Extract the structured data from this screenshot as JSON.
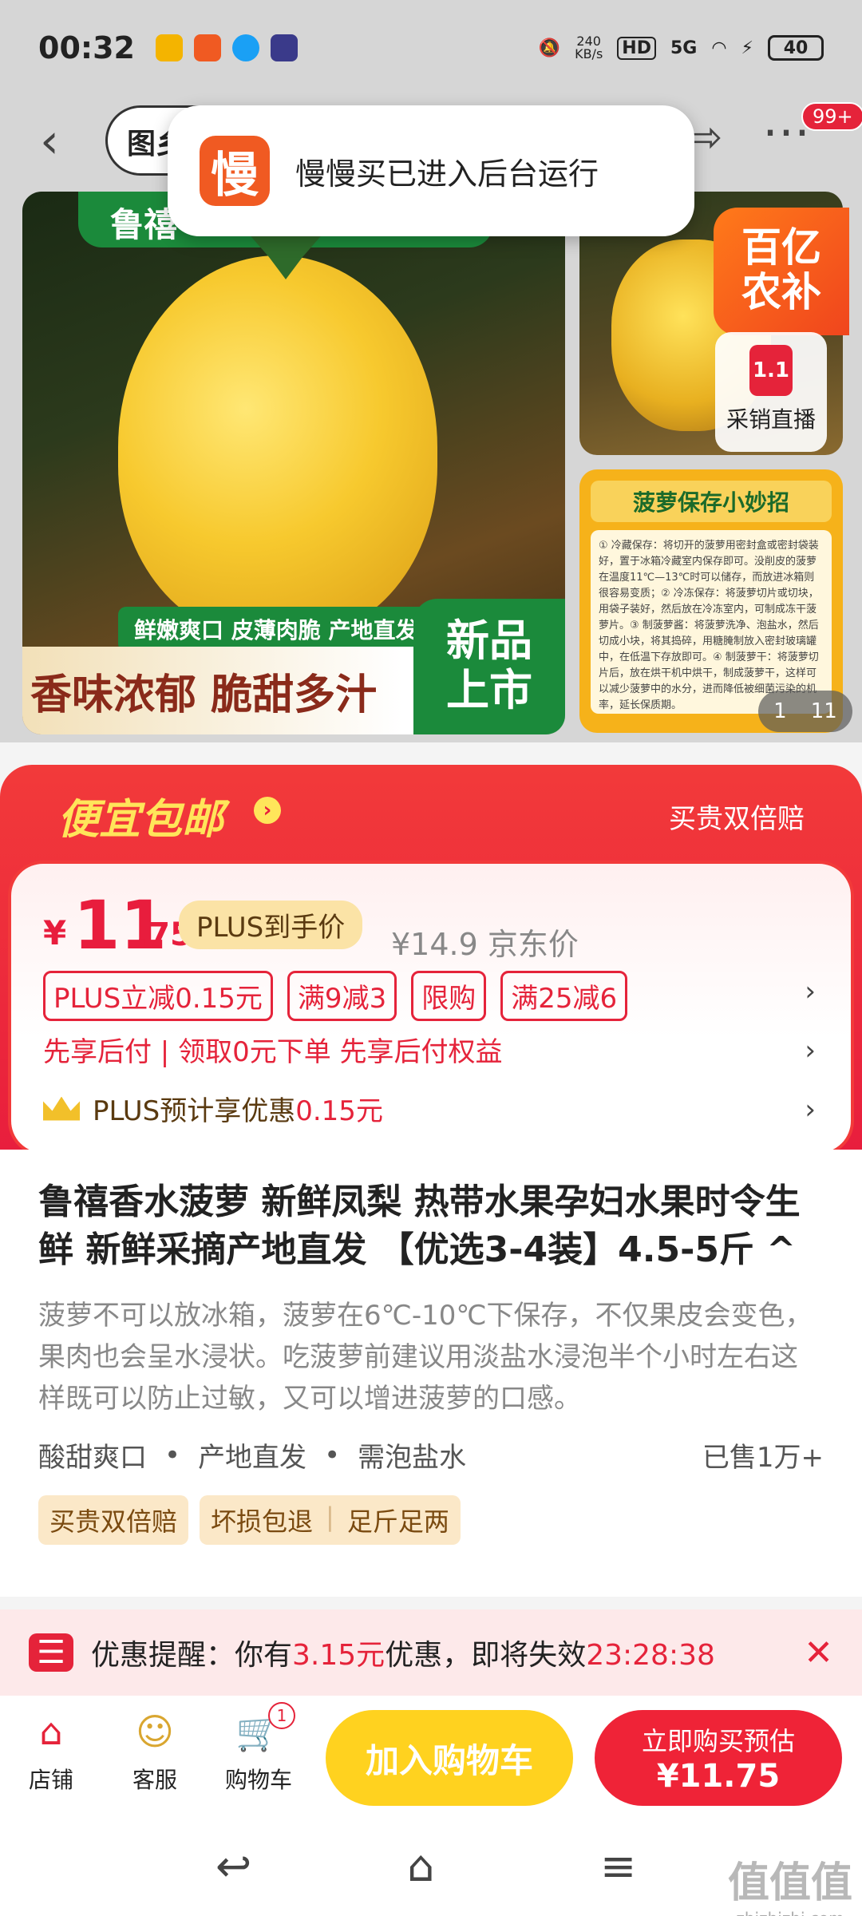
{
  "status_bar": {
    "time": "00:32",
    "net_speed": "240\nKB/s",
    "hd": "HD",
    "signal": "5G",
    "battery": "40"
  },
  "nav": {
    "search_prefix": "图乡",
    "more_badge": "99+"
  },
  "toast": {
    "logo_char": "慢",
    "text": "慢慢买已进入后台运行"
  },
  "gallery": {
    "brand": "鲁禧",
    "features": "鲜嫩爽口 皮薄肉脆 产地直发",
    "slogan": "香味浓郁 脆甜多汁",
    "new_badge_line1": "新品",
    "new_badge_line2": "上市",
    "promo_line1": "百亿",
    "promo_line2": "农补",
    "live_logo": "1.1",
    "live_label": "采销直播",
    "tips_title": "菠萝保存小妙招",
    "tips_body": "① 冷藏保存：将切开的菠萝用密封盒或密封袋装好，置于冰箱冷藏室内保存即可。没削皮的菠萝在温度11℃—13℃时可以储存，而放进冰箱则很容易变质；② 冷冻保存：将菠萝切片或切块，用袋子装好，然后放在冷冻室内，可制成冻干菠萝片。③ 制菠萝酱：将菠萝洗净、泡盐水，然后切成小块，将其捣碎，用糖腌制放入密封玻璃罐中，在低温下存放即可。④ 制菠萝干：将菠萝切片后，放在烘干机中烘干，制成菠萝干，这样可以减少菠萝中的水分，进而降低被细菌污染的机率，延长保质期。",
    "pager_current": "1",
    "pager_total": "11"
  },
  "price": {
    "cheap_label": "便宜包邮",
    "cheap_arrow": "›",
    "double_comp": "买贵双倍赔",
    "currency": "¥",
    "integer": "11",
    "decimal": ".75",
    "plus_tag": "PLUS到手价",
    "jd_price": "¥14.9 京东价",
    "tags": [
      "PLUS立减0.15元",
      "满9减3",
      "限购",
      "满25减6"
    ],
    "pay_line": "先享后付 | 领取0元下单 先享后付权益",
    "plus_line_prefix": "PLUS预计享优惠",
    "plus_line_amount": "0.15元",
    "row_arrow": "›"
  },
  "product": {
    "title": "鲁禧香水菠萝  新鲜凤梨 热带水果孕妇水果时令生鲜 新鲜采摘产地直发 【优选3-4装】4.5-5斤 ^",
    "description": "菠萝不可以放冰箱，菠萝在6℃-10℃下保存，不仅果皮会变色，果肉也会呈水浸状。吃菠萝前建议用淡盐水浸泡半个小时左右这样既可以防止过敏，又可以增进菠萝的口感。",
    "features": [
      "酸甜爽口",
      "产地直发",
      "需泡盐水"
    ],
    "sold": "已售1万+",
    "services": [
      "买贵双倍赔"
    ],
    "service_group": [
      "坏损包退",
      "足斤足两"
    ]
  },
  "reminder": {
    "label": "优惠提醒：你有",
    "amount": "3.15元",
    "label2": "优惠，即将失效",
    "countdown": "23:28:38",
    "close": "✕"
  },
  "bottom_bar": {
    "shop": "店铺",
    "service": "客服",
    "cart": "购物车",
    "cart_count": "1",
    "add_to_cart": "加入购物车",
    "buy_line1": "立即购买预估",
    "buy_line2": "¥11.75"
  },
  "watermark": {
    "main": "值值值",
    "sub": "zhizhizhi.com"
  },
  "colors": {
    "accent_red": "#e81d3d",
    "cart_yellow": "#ffd21f",
    "buy_red": "#ef2337",
    "green": "#1b8a3b"
  }
}
